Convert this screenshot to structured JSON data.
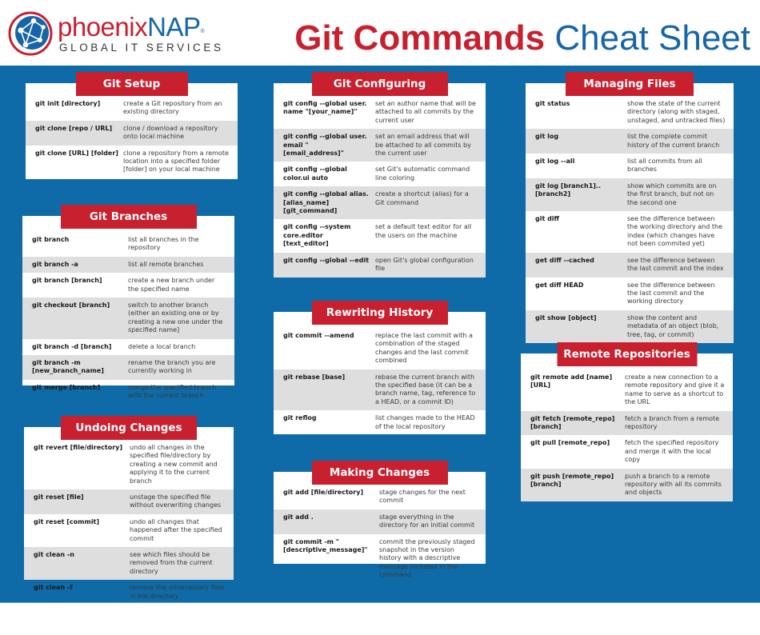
{
  "header": {
    "logo": {
      "name_part1": "phoenix",
      "name_part2": "NAP",
      "registered": "®",
      "tagline": "GLOBAL IT SERVICES"
    },
    "title_bold": "Git Commands",
    "title_light": " Cheat Sheet"
  },
  "colors": {
    "brand_red": "#c8202f",
    "brand_blue": "#1565a8",
    "board_blue": "#0f6aa8",
    "row_alt": "#dedede"
  },
  "sections": {
    "setup": {
      "title": "Git Setup",
      "rows": [
        {
          "cmd": "git init [directory]",
          "desc": "create a Git repository from an existing directory"
        },
        {
          "cmd": "git clone [repo / URL]",
          "desc": "clone / download a repository onto local machine"
        },
        {
          "cmd": "git clone [URL] [folder]",
          "desc": "clone a repository from a remote location into a specified folder [folder] on your local machine"
        }
      ]
    },
    "branches": {
      "title": "Git Branches",
      "rows": [
        {
          "cmd": "git branch",
          "desc": "list all branches in the repository"
        },
        {
          "cmd": "git branch -a",
          "desc": "list all remote branches"
        },
        {
          "cmd": "git branch [branch]",
          "desc": "create a new branch under the specified name"
        },
        {
          "cmd": "git checkout [branch]",
          "desc": "switch to another branch (either an existing one or by creating a new one under the specified name]"
        },
        {
          "cmd": "git branch -d [branch]",
          "desc": "delete a local branch"
        },
        {
          "cmd": "git branch -m [new_branch_name]",
          "desc": "rename the branch you are currently working in"
        },
        {
          "cmd": "git merge [branch]",
          "desc": "merge the specified branch with the current branch"
        }
      ]
    },
    "undoing": {
      "title": "Undoing Changes",
      "rows": [
        {
          "cmd": "git revert [file/directory]",
          "desc": "undo all changes in the specified file/directory by creating a new commit and applying it to the current branch"
        },
        {
          "cmd": "git reset [file]",
          "desc": "unstage the specified file without overwriting changes"
        },
        {
          "cmd": "git reset [commit]",
          "desc": "undo all changes that happened after the specified commit"
        },
        {
          "cmd": "git clean -n",
          "desc": "see which files should be removed from the current directory"
        },
        {
          "cmd": "git clean -f",
          "desc": "remove the unnecessary files in the directory"
        }
      ]
    },
    "configuring": {
      "title": "Git Configuring",
      "rows": [
        {
          "cmd": "git config --global user. name \"[your_name]\"",
          "desc": "set an author name that will be attached to all commits by the current user"
        },
        {
          "cmd": "git config --global user. email \" [email_address]\"",
          "desc": "set an email address that will be attached to all commits by the current user"
        },
        {
          "cmd": "git config --global color.ui auto",
          "desc": "set Git's automatic command line coloring"
        },
        {
          "cmd": "git config --global alias. [alias_name] [git_command]",
          "desc": "create a shortcut (alias) for a Git command"
        },
        {
          "cmd": "git config --system core.editor [text_editor]",
          "desc": "set a default text editor for all the users on the machine"
        },
        {
          "cmd": "git config --global --edit",
          "desc": "open Git's global configuration file"
        }
      ]
    },
    "rewriting": {
      "title": "Rewriting History",
      "rows": [
        {
          "cmd": "git commit --amend",
          "desc": "replace the last commit with a combination of the staged changes and the last commit combined"
        },
        {
          "cmd": "git rebase [base]",
          "desc": "rebase the current branch with the specified base (it can be a branch name, tag, reference to a HEAD, or a commit ID)"
        },
        {
          "cmd": "git reflog",
          "desc": "list changes made to the HEAD of the local repository"
        }
      ]
    },
    "making": {
      "title": "Making Changes",
      "rows": [
        {
          "cmd": "git add [file/directory]",
          "desc": "stage changes for the next commit"
        },
        {
          "cmd": "git add .",
          "desc": "stage everything in the directory for an initial commit"
        },
        {
          "cmd": "git commit -m \" [descriptive_message]\"",
          "desc": "commit the previously staged snapshot in the version history with a descriptive message included in the command"
        }
      ]
    },
    "managing": {
      "title": "Managing Files",
      "rows": [
        {
          "cmd": "git status",
          "desc": "show the state of the current directory (along with staged, unstaged, and untracked files)"
        },
        {
          "cmd": "git log",
          "desc": "list the complete commit history of the current branch"
        },
        {
          "cmd": "git log --all",
          "desc": "list all commits from all branches"
        },
        {
          "cmd": "git log [branch1]..[branch2]",
          "desc": "show which commits are on the first branch, but not on the second one"
        },
        {
          "cmd": "git diff",
          "desc": "see the difference between the working directory and the index (which changes have not been commited yet)"
        },
        {
          "cmd": "get diff --cached",
          "desc": "see the difference between the last commit and the index"
        },
        {
          "cmd": "get diff HEAD",
          "desc": "see the difference between the last commit and the working directory"
        },
        {
          "cmd": "git show [object]",
          "desc": "show the content and metadata of an object (blob, tree, tag, or commit)"
        }
      ]
    },
    "remote": {
      "title": "Remote Repositories",
      "rows": [
        {
          "cmd": "git remote add [name] [URL]",
          "desc": "create a new connection to a remote repository and give it a name to serve as a shortcut to the URL"
        },
        {
          "cmd": "git fetch [remote_repo] [branch]",
          "desc": "fetch a branch from a remote repository"
        },
        {
          "cmd": "git pull [remote_repo]",
          "desc": "fetch the specified repository and merge it with the local copy"
        },
        {
          "cmd": "git push [remote_repo] [branch]",
          "desc": "push a branch to a remote repository with all its commits and objects"
        }
      ]
    }
  }
}
